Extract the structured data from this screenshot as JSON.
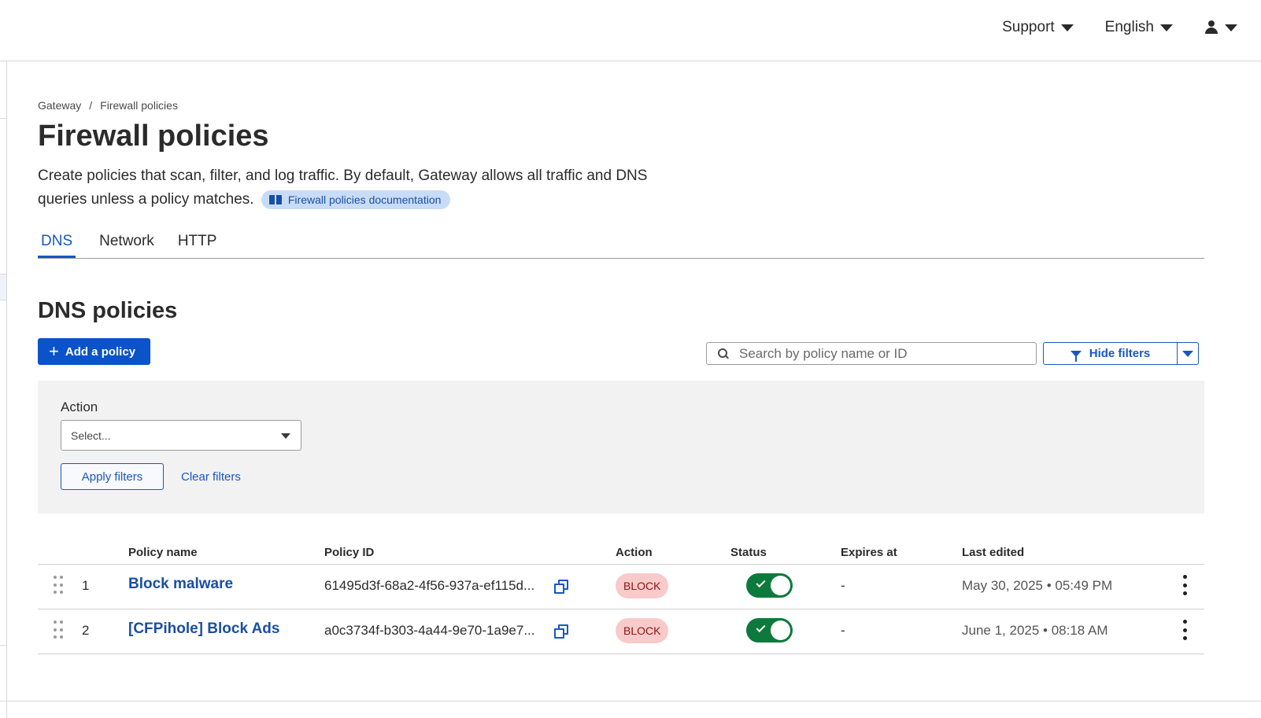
{
  "topnav": {
    "support_label": "Support",
    "language_label": "English",
    "user_icon": "user-icon"
  },
  "breadcrumb": {
    "items": [
      "Gateway",
      "Firewall policies"
    ],
    "separator": "/"
  },
  "page": {
    "title": "Firewall policies",
    "description": "Create policies that scan, filter, and log traffic. By default, Gateway allows all traffic and DNS queries unless a policy matches.",
    "doc_link_label": "Firewall policies documentation"
  },
  "tabs": [
    {
      "label": "DNS",
      "active": true
    },
    {
      "label": "Network",
      "active": false
    },
    {
      "label": "HTTP",
      "active": false
    }
  ],
  "section": {
    "title": "DNS policies",
    "add_button_label": "Add a policy",
    "search_placeholder": "Search by policy name or ID",
    "hide_filters_label": "Hide filters"
  },
  "filters": {
    "action_label": "Action",
    "action_select_value": "Select...",
    "apply_label": "Apply filters",
    "clear_label": "Clear filters"
  },
  "table": {
    "columns": [
      "Policy name",
      "Policy ID",
      "Action",
      "Status",
      "Expires at",
      "Last edited"
    ],
    "rows": [
      {
        "index": "1",
        "name": "Block malware",
        "id": "61495d3f-68a2-4f56-937a-ef115d...",
        "action": "BLOCK",
        "enabled": true,
        "expires": "-",
        "last_edited": "May 30, 2025 • 05:49 PM"
      },
      {
        "index": "2",
        "name": "[CFPihole] Block Ads",
        "id": "a0c3734f-b303-4a44-9e70-1a9e7...",
        "action": "BLOCK",
        "enabled": true,
        "expires": "-",
        "last_edited": "June 1, 2025 • 08:18 AM"
      }
    ]
  },
  "colors": {
    "accent": "#0a53c9",
    "link": "#1a4fa0",
    "block_badge_bg": "#f9caca",
    "toggle_on": "#0c7a3d",
    "filter_panel_bg": "#f2f2f2"
  }
}
